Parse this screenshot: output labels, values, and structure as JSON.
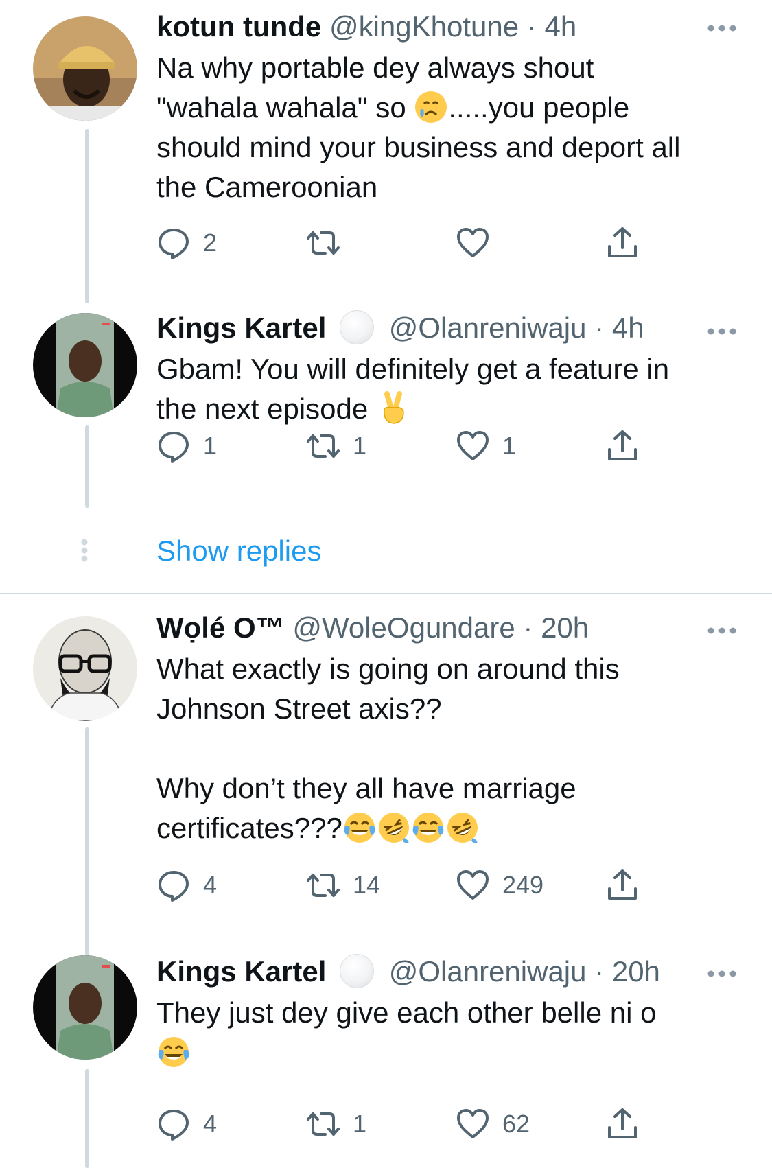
{
  "tweets": [
    {
      "name": "kotun tunde",
      "handle": "@kingKhotune",
      "dot": "·",
      "time": "4h",
      "verified": false,
      "text_parts": [
        "Na why portable dey always shout\n\"wahala wahala\" so ",
        ".....you people\nshould mind your business and deport all\nthe Cameroonian"
      ],
      "emoji": [
        "sad-but-relieved-face"
      ],
      "replies": "2",
      "retweets": "",
      "likes": ""
    },
    {
      "name": "Kings Kartel",
      "handle": "@Olanreniwaju",
      "dot": "·",
      "time": "4h",
      "verified": true,
      "text_parts": [
        "Gbam! You will definitely get a feature in\nthe next episode "
      ],
      "emoji": [
        "victory-hand"
      ],
      "replies": "1",
      "retweets": "1",
      "likes": "1"
    },
    {
      "name": "Wọlé O™",
      "handle": "@WoleOgundare",
      "dot": "·",
      "time": "20h",
      "verified": false,
      "text_parts": [
        "What exactly is going on around this\nJohnson Street axis??\n\nWhy don’t they all have marriage\ncertificates???"
      ],
      "emoji": [
        "face-with-tears-of-joy",
        "rolling-on-the-floor-laughing",
        "face-with-tears-of-joy",
        "rolling-on-the-floor-laughing"
      ],
      "replies": "4",
      "retweets": "14",
      "likes": "249"
    },
    {
      "name": "Kings Kartel",
      "handle": "@Olanreniwaju",
      "dot": "·",
      "time": "20h",
      "verified": true,
      "text_parts": [
        "They just dey give each other belle ni o\n"
      ],
      "emoji": [
        "face-with-tears-of-joy"
      ],
      "replies": "4",
      "retweets": "1",
      "likes": "62"
    }
  ],
  "show_replies": "Show replies",
  "colors": {
    "accent": "#1d9bf0",
    "text": "#0f1419",
    "muted": "#536471",
    "line": "#cfd9de"
  },
  "icons": [
    "reply-icon",
    "retweet-icon",
    "like-icon",
    "share-icon",
    "more-icon",
    "thread-dots-icon"
  ]
}
